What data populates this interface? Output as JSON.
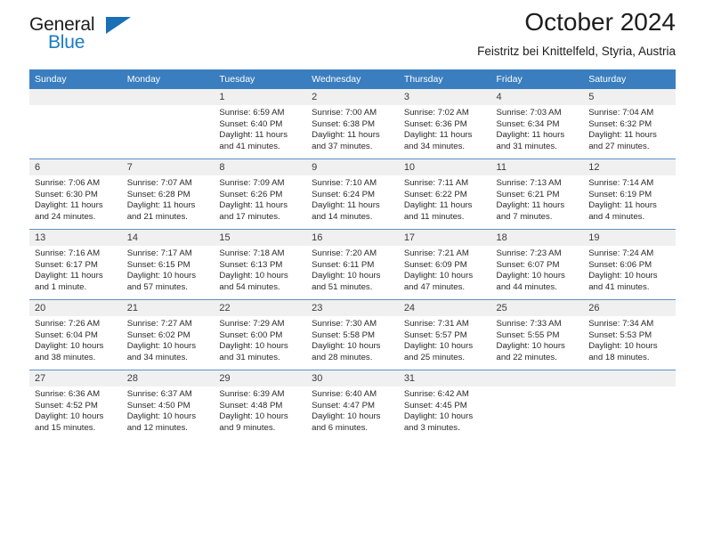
{
  "brand": {
    "word1": "General",
    "word2": "Blue",
    "triangle_icon": "triangle-icon",
    "accent_color": "#1a7bc4"
  },
  "header": {
    "title": "October 2024",
    "subtitle": "Feistritz bei Knittelfeld, Styria, Austria"
  },
  "theme": {
    "header_row_bg": "#3a7ebf",
    "daynum_bg": "#f0f0f0",
    "grid_line": "#5b92c7",
    "text": "#2a2a2a"
  },
  "weekday_headers": [
    "Sunday",
    "Monday",
    "Tuesday",
    "Wednesday",
    "Thursday",
    "Friday",
    "Saturday"
  ],
  "weeks": [
    [
      {
        "day": "",
        "empty": true,
        "sunrise": "",
        "sunset": "",
        "daylight1": "",
        "daylight2": ""
      },
      {
        "day": "",
        "empty": true,
        "sunrise": "",
        "sunset": "",
        "daylight1": "",
        "daylight2": ""
      },
      {
        "day": "1",
        "sunrise": "Sunrise: 6:59 AM",
        "sunset": "Sunset: 6:40 PM",
        "daylight1": "Daylight: 11 hours",
        "daylight2": "and 41 minutes."
      },
      {
        "day": "2",
        "sunrise": "Sunrise: 7:00 AM",
        "sunset": "Sunset: 6:38 PM",
        "daylight1": "Daylight: 11 hours",
        "daylight2": "and 37 minutes."
      },
      {
        "day": "3",
        "sunrise": "Sunrise: 7:02 AM",
        "sunset": "Sunset: 6:36 PM",
        "daylight1": "Daylight: 11 hours",
        "daylight2": "and 34 minutes."
      },
      {
        "day": "4",
        "sunrise": "Sunrise: 7:03 AM",
        "sunset": "Sunset: 6:34 PM",
        "daylight1": "Daylight: 11 hours",
        "daylight2": "and 31 minutes."
      },
      {
        "day": "5",
        "sunrise": "Sunrise: 7:04 AM",
        "sunset": "Sunset: 6:32 PM",
        "daylight1": "Daylight: 11 hours",
        "daylight2": "and 27 minutes."
      }
    ],
    [
      {
        "day": "6",
        "sunrise": "Sunrise: 7:06 AM",
        "sunset": "Sunset: 6:30 PM",
        "daylight1": "Daylight: 11 hours",
        "daylight2": "and 24 minutes."
      },
      {
        "day": "7",
        "sunrise": "Sunrise: 7:07 AM",
        "sunset": "Sunset: 6:28 PM",
        "daylight1": "Daylight: 11 hours",
        "daylight2": "and 21 minutes."
      },
      {
        "day": "8",
        "sunrise": "Sunrise: 7:09 AM",
        "sunset": "Sunset: 6:26 PM",
        "daylight1": "Daylight: 11 hours",
        "daylight2": "and 17 minutes."
      },
      {
        "day": "9",
        "sunrise": "Sunrise: 7:10 AM",
        "sunset": "Sunset: 6:24 PM",
        "daylight1": "Daylight: 11 hours",
        "daylight2": "and 14 minutes."
      },
      {
        "day": "10",
        "sunrise": "Sunrise: 7:11 AM",
        "sunset": "Sunset: 6:22 PM",
        "daylight1": "Daylight: 11 hours",
        "daylight2": "and 11 minutes."
      },
      {
        "day": "11",
        "sunrise": "Sunrise: 7:13 AM",
        "sunset": "Sunset: 6:21 PM",
        "daylight1": "Daylight: 11 hours",
        "daylight2": "and 7 minutes."
      },
      {
        "day": "12",
        "sunrise": "Sunrise: 7:14 AM",
        "sunset": "Sunset: 6:19 PM",
        "daylight1": "Daylight: 11 hours",
        "daylight2": "and 4 minutes."
      }
    ],
    [
      {
        "day": "13",
        "sunrise": "Sunrise: 7:16 AM",
        "sunset": "Sunset: 6:17 PM",
        "daylight1": "Daylight: 11 hours",
        "daylight2": "and 1 minute."
      },
      {
        "day": "14",
        "sunrise": "Sunrise: 7:17 AM",
        "sunset": "Sunset: 6:15 PM",
        "daylight1": "Daylight: 10 hours",
        "daylight2": "and 57 minutes."
      },
      {
        "day": "15",
        "sunrise": "Sunrise: 7:18 AM",
        "sunset": "Sunset: 6:13 PM",
        "daylight1": "Daylight: 10 hours",
        "daylight2": "and 54 minutes."
      },
      {
        "day": "16",
        "sunrise": "Sunrise: 7:20 AM",
        "sunset": "Sunset: 6:11 PM",
        "daylight1": "Daylight: 10 hours",
        "daylight2": "and 51 minutes."
      },
      {
        "day": "17",
        "sunrise": "Sunrise: 7:21 AM",
        "sunset": "Sunset: 6:09 PM",
        "daylight1": "Daylight: 10 hours",
        "daylight2": "and 47 minutes."
      },
      {
        "day": "18",
        "sunrise": "Sunrise: 7:23 AM",
        "sunset": "Sunset: 6:07 PM",
        "daylight1": "Daylight: 10 hours",
        "daylight2": "and 44 minutes."
      },
      {
        "day": "19",
        "sunrise": "Sunrise: 7:24 AM",
        "sunset": "Sunset: 6:06 PM",
        "daylight1": "Daylight: 10 hours",
        "daylight2": "and 41 minutes."
      }
    ],
    [
      {
        "day": "20",
        "sunrise": "Sunrise: 7:26 AM",
        "sunset": "Sunset: 6:04 PM",
        "daylight1": "Daylight: 10 hours",
        "daylight2": "and 38 minutes."
      },
      {
        "day": "21",
        "sunrise": "Sunrise: 7:27 AM",
        "sunset": "Sunset: 6:02 PM",
        "daylight1": "Daylight: 10 hours",
        "daylight2": "and 34 minutes."
      },
      {
        "day": "22",
        "sunrise": "Sunrise: 7:29 AM",
        "sunset": "Sunset: 6:00 PM",
        "daylight1": "Daylight: 10 hours",
        "daylight2": "and 31 minutes."
      },
      {
        "day": "23",
        "sunrise": "Sunrise: 7:30 AM",
        "sunset": "Sunset: 5:58 PM",
        "daylight1": "Daylight: 10 hours",
        "daylight2": "and 28 minutes."
      },
      {
        "day": "24",
        "sunrise": "Sunrise: 7:31 AM",
        "sunset": "Sunset: 5:57 PM",
        "daylight1": "Daylight: 10 hours",
        "daylight2": "and 25 minutes."
      },
      {
        "day": "25",
        "sunrise": "Sunrise: 7:33 AM",
        "sunset": "Sunset: 5:55 PM",
        "daylight1": "Daylight: 10 hours",
        "daylight2": "and 22 minutes."
      },
      {
        "day": "26",
        "sunrise": "Sunrise: 7:34 AM",
        "sunset": "Sunset: 5:53 PM",
        "daylight1": "Daylight: 10 hours",
        "daylight2": "and 18 minutes."
      }
    ],
    [
      {
        "day": "27",
        "sunrise": "Sunrise: 6:36 AM",
        "sunset": "Sunset: 4:52 PM",
        "daylight1": "Daylight: 10 hours",
        "daylight2": "and 15 minutes."
      },
      {
        "day": "28",
        "sunrise": "Sunrise: 6:37 AM",
        "sunset": "Sunset: 4:50 PM",
        "daylight1": "Daylight: 10 hours",
        "daylight2": "and 12 minutes."
      },
      {
        "day": "29",
        "sunrise": "Sunrise: 6:39 AM",
        "sunset": "Sunset: 4:48 PM",
        "daylight1": "Daylight: 10 hours",
        "daylight2": "and 9 minutes."
      },
      {
        "day": "30",
        "sunrise": "Sunrise: 6:40 AM",
        "sunset": "Sunset: 4:47 PM",
        "daylight1": "Daylight: 10 hours",
        "daylight2": "and 6 minutes."
      },
      {
        "day": "31",
        "sunrise": "Sunrise: 6:42 AM",
        "sunset": "Sunset: 4:45 PM",
        "daylight1": "Daylight: 10 hours",
        "daylight2": "and 3 minutes."
      },
      {
        "day": "",
        "empty": true,
        "sunrise": "",
        "sunset": "",
        "daylight1": "",
        "daylight2": ""
      },
      {
        "day": "",
        "empty": true,
        "sunrise": "",
        "sunset": "",
        "daylight1": "",
        "daylight2": ""
      }
    ]
  ]
}
